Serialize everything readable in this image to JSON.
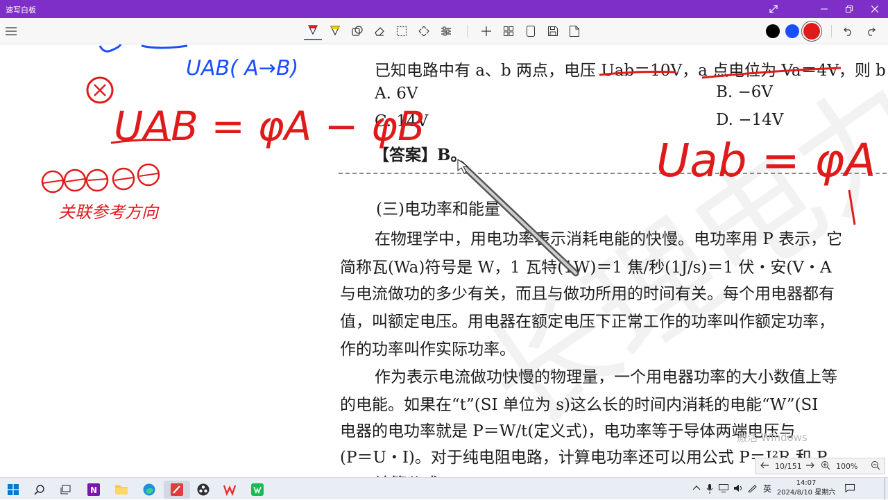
{
  "window": {
    "title": "速写白板"
  },
  "window_controls": [
    "expand-icon",
    "minimize-icon",
    "restore-icon",
    "close-icon"
  ],
  "toolbar": {
    "tools": [
      "pen-icon",
      "highlighter-icon",
      "shape-icon",
      "eraser-icon",
      "select-icon",
      "move-icon",
      "settings-sliders-icon"
    ],
    "actions": [
      "plus-icon",
      "grid-icon",
      "page-icon",
      "save-icon",
      "export-icon"
    ],
    "colors": [
      "#000000",
      "#1a4fff",
      "#e01a1a"
    ],
    "selected_color": "#e01a1a",
    "history": [
      "undo-icon",
      "redo-icon"
    ]
  },
  "document": {
    "question": "已知电路中有 a、b 两点，电压 Uab＝10V，a 点电位为 Va＝4V，则 b 点",
    "options": [
      "A. 6V",
      "B. −6V",
      "C. 14V",
      "D. −14V"
    ],
    "answer": "【答案】B。",
    "section_title": "(三)电功率和能量",
    "paragraphs": [
      "在物理学中，用电功率表示消耗电能的快慢。电功率用 P 表示，它",
      "简称瓦(Wa)符号是 W，1 瓦特(1W)＝1 焦/秒(1J/s)＝1 伏・安(V・A",
      "与电流做功的多少有关，而且与做功所用的时间有关。每个用电器都有",
      "值，叫额定电压。用电器在额定电压下正常工作的功率叫作额定功率，",
      "作的功率叫作实际功率。",
      "作为表示电流做功快慢的物理量，一个用电器功率的大小数值上等",
      "的电能。如果在“t”(SI 单位为 s)这么长的时间内消耗的电能“W”(SI",
      "电器的电功率就是 P＝W/t(定义式)，电功率等于导体两端电压与",
      "(P＝U・I)。对于纯电阻电路，计算电功率还可以用公式 P＝I²R 和 P",
      "计算公式"
    ]
  },
  "annotations": {
    "blue_note": "UAB( A→B)",
    "red_formula_left": "UAB = φA − φB",
    "red_formula_right": "Uab = φA − φb",
    "red_note": "关联参考方向",
    "watermark_chars": "长理电力"
  },
  "activation_watermark": "激活 Windows",
  "page_nav": {
    "page": "10/151",
    "zoom": "100%"
  },
  "taskbar": {
    "apps": [
      "start-icon",
      "search-icon",
      "task-view-icon",
      "onenote-icon",
      "file-explorer-icon",
      "edge-icon",
      "whiteboard-icon",
      "obs-icon",
      "wps-icon",
      "wechat-icon"
    ],
    "ime": "英",
    "time": "14:07",
    "date": "2024/8/10 星期六"
  }
}
